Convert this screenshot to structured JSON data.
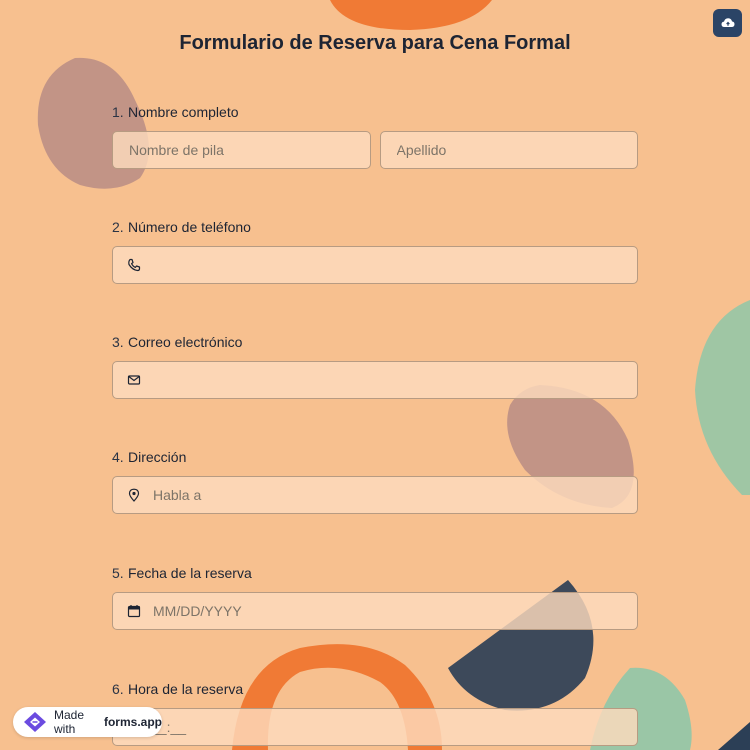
{
  "form": {
    "title": "Formulario de Reserva para Cena Formal"
  },
  "questions": [
    {
      "number": "1.",
      "label": "Nombre completo",
      "first_placeholder": "Nombre de pila",
      "last_placeholder": "Apellido"
    },
    {
      "number": "2.",
      "label": "Número de teléfono",
      "placeholder": "",
      "icon": "phone-icon"
    },
    {
      "number": "3.",
      "label": "Correo electrónico",
      "placeholder": "",
      "icon": "envelope-icon"
    },
    {
      "number": "4.",
      "label": "Dirección",
      "placeholder": "Habla a",
      "icon": "map-pin-icon"
    },
    {
      "number": "5.",
      "label": "Fecha de la reserva",
      "placeholder": "MM/DD/YYYY",
      "icon": "calendar-icon"
    },
    {
      "number": "6.",
      "label": "Hora de la reserva",
      "placeholder": "__:__",
      "icon": ""
    }
  ],
  "badge": {
    "prefix": "Made with",
    "brand": "forms.app"
  },
  "toolbar": {
    "save_icon": "cloud-upload-icon"
  },
  "colors": {
    "background": "#f7c08f",
    "accent": "#2b4466",
    "orange": "#f07a35"
  }
}
